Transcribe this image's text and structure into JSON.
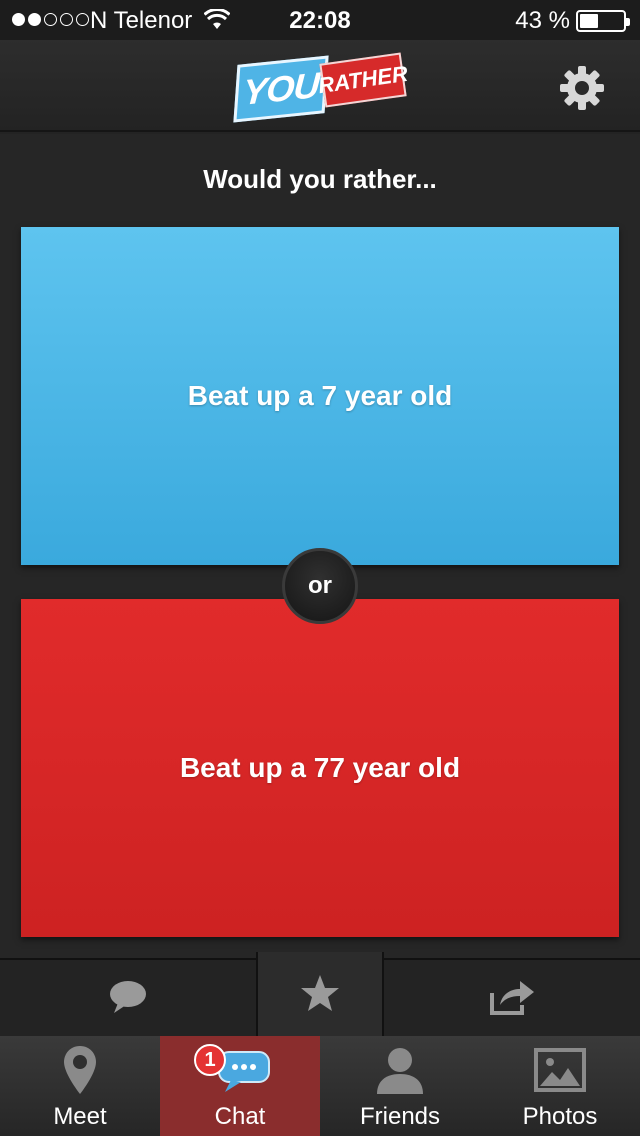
{
  "status_bar": {
    "carrier": "N Telenor",
    "time": "22:08",
    "battery_percent": "43 %",
    "signal_bars_filled": 2,
    "signal_bars_total": 5,
    "battery_level": 0.43
  },
  "header": {
    "logo_part1": "YOU",
    "logo_part2": "RATHER",
    "settings_icon": "gear-icon"
  },
  "question": {
    "prompt": "Would you rather...",
    "option_a": "Beat up a 7 year old",
    "separator": "or",
    "option_b": "Beat up a 77 year old"
  },
  "actions": [
    {
      "name": "comment",
      "icon": "speech-bubble-icon"
    },
    {
      "name": "favorite",
      "icon": "star-icon"
    },
    {
      "name": "share",
      "icon": "share-icon"
    }
  ],
  "tabs": [
    {
      "label": "Meet",
      "icon": "location-pin-icon",
      "active": false
    },
    {
      "label": "Chat",
      "icon": "chat-bubbles-icon",
      "active": true,
      "badge": "1"
    },
    {
      "label": "Friends",
      "icon": "person-icon",
      "active": false
    },
    {
      "label": "Photos",
      "icon": "photo-icon",
      "active": false
    }
  ],
  "colors": {
    "option_a": "#4db7e6",
    "option_b": "#d62626",
    "active_tab": "#8a2d2d"
  }
}
